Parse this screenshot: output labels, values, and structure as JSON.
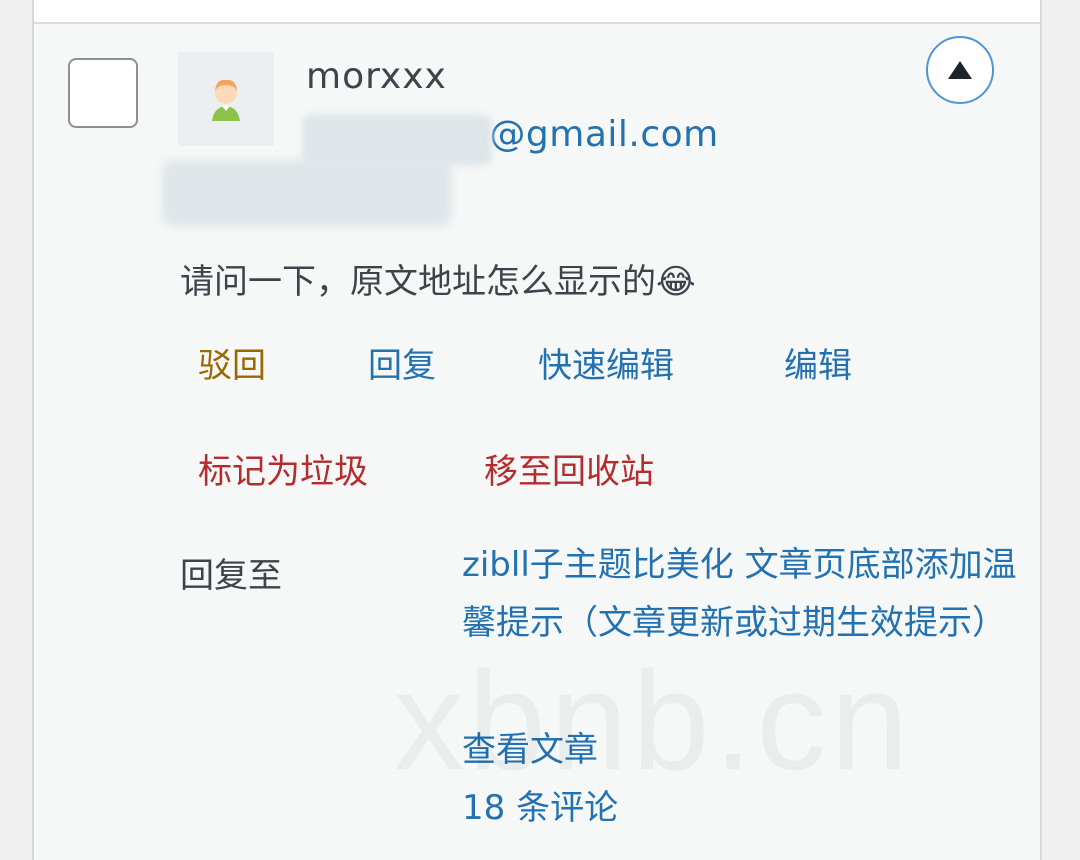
{
  "comment": {
    "author_name": "morxxx",
    "author_email_visible": "3@gmail.com",
    "text": "请问一下，原文地址怎么显示的😂"
  },
  "actions": {
    "unapprove": "驳回",
    "reply": "回复",
    "quick_edit": "快速编辑",
    "edit": "编辑",
    "spam": "标记为垃圾",
    "trash": "移至回收站"
  },
  "response": {
    "reply_to_label": "回复至",
    "post_title": "zibll子主题比美化 文章页底部添加温馨提示（文章更新或过期生效提示）",
    "view_post": "查看文章",
    "comments_count": "18 条评论"
  },
  "watermark": "xbnb.cn",
  "icons": {
    "avatar": "default-avatar-icon",
    "toggle": "triangle-up-icon"
  },
  "colors": {
    "link": "#2271b1",
    "unapprove": "#996800",
    "danger": "#b32d2e"
  }
}
